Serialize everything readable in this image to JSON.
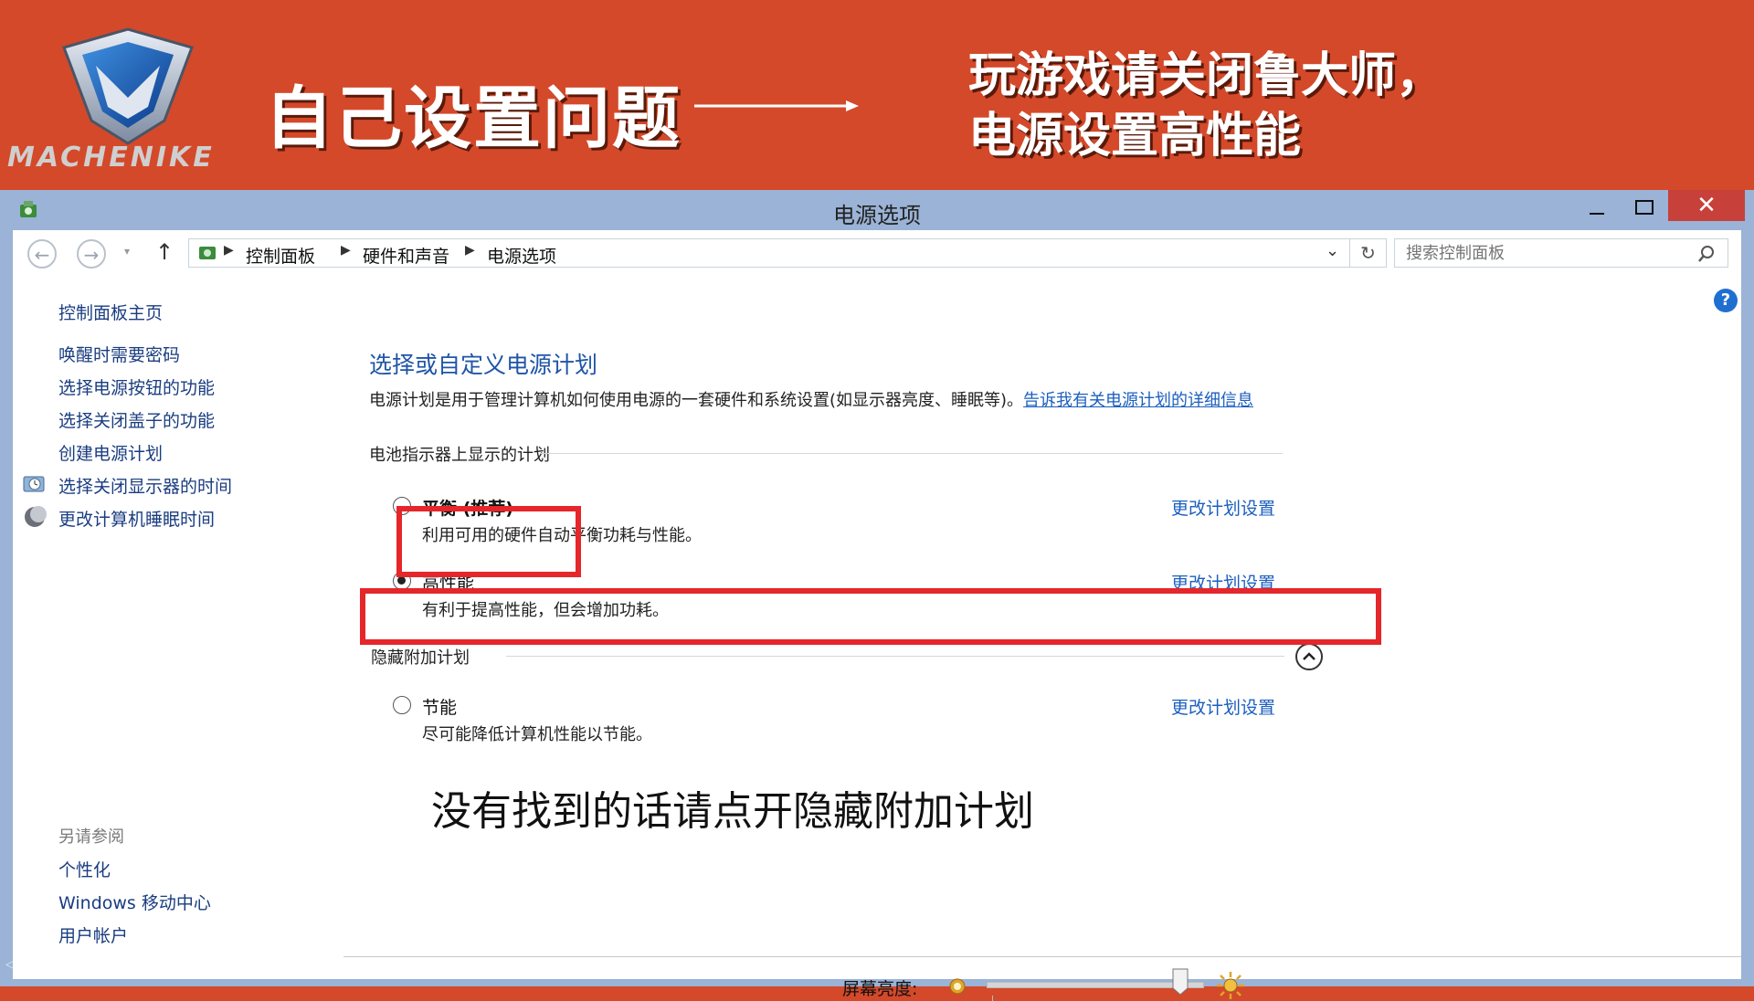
{
  "banner": {
    "logo_text": "MACHENIKE",
    "headline": "自己设置问题",
    "right_line1": "玩游戏请关闭鲁大师，",
    "right_line2": "电源设置高性能"
  },
  "window": {
    "title": "电源选项",
    "close_label": "✕"
  },
  "address": {
    "crumbs": [
      "控制面板",
      "硬件和声音",
      "电源选项"
    ],
    "search_placeholder": "搜索控制面板"
  },
  "sidebar": {
    "home": "控制面板主页",
    "items": [
      {
        "label": "唤醒时需要密码"
      },
      {
        "label": "选择电源按钮的功能"
      },
      {
        "label": "选择关闭盖子的功能"
      },
      {
        "label": "创建电源计划"
      },
      {
        "label": "选择关闭显示器的时间",
        "icon": "monitor-clock-icon"
      },
      {
        "label": "更改计算机睡眠时间",
        "icon": "moon-icon"
      }
    ],
    "see_also": "另请参阅",
    "see_also_items": [
      {
        "label": "个性化"
      },
      {
        "label": "Windows 移动中心"
      },
      {
        "label": "用户帐户"
      }
    ]
  },
  "main": {
    "heading": "选择或自定义电源计划",
    "description": "电源计划是用于管理计算机如何使用电源的一套硬件和系统设置(如显示器亮度、睡眠等)。",
    "description_link": "告诉我有关电源计划的详细信息",
    "group_header": "电池指示器上显示的计划",
    "plans": [
      {
        "name": "平衡 (推荐)",
        "desc": "利用可用的硬件自动平衡功耗与性能。",
        "link": "更改计划设置",
        "selected": false
      },
      {
        "name": "高性能",
        "desc": "有利于提高性能，但会增加功耗。",
        "link": "更改计划设置",
        "selected": true
      }
    ],
    "hidden_header": "隐藏附加计划",
    "hidden_plans": [
      {
        "name": "节能",
        "desc": "尽可能降低计算机性能以节能。",
        "link": "更改计划设置",
        "selected": false
      }
    ],
    "note": "没有找到的话请点开隐藏附加计划"
  },
  "brightness": {
    "label": "屏幕亮度:",
    "level": 0.9
  },
  "colors": {
    "banner_bg": "#d4492a",
    "highlight": "#e5262a",
    "link": "#1c5fbf"
  }
}
